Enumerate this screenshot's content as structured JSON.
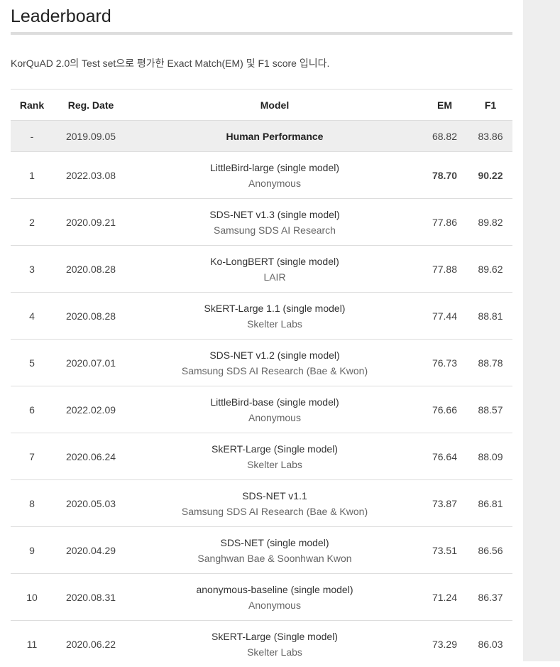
{
  "page": {
    "title": "Leaderboard",
    "description": "KorQuAD 2.0의 Test set으로 평가한 Exact Match(EM) 및 F1 score 입니다."
  },
  "table": {
    "headers": {
      "rank": "Rank",
      "date": "Reg. Date",
      "model": "Model",
      "em": "EM",
      "f1": "F1"
    },
    "human": {
      "rank": "-",
      "date": "2019.09.05",
      "model": "Human Performance",
      "em": "68.82",
      "f1": "83.86"
    },
    "rows": [
      {
        "rank": "1",
        "date": "2022.03.08",
        "model": "LittleBird-large (single model)",
        "institution": "Anonymous",
        "em": "78.70",
        "f1": "90.22"
      },
      {
        "rank": "2",
        "date": "2020.09.21",
        "model": "SDS-NET v1.3 (single model)",
        "institution": "Samsung SDS AI Research",
        "em": "77.86",
        "f1": "89.82"
      },
      {
        "rank": "3",
        "date": "2020.08.28",
        "model": "Ko-LongBERT (single model)",
        "institution": "LAIR",
        "em": "77.88",
        "f1": "89.62"
      },
      {
        "rank": "4",
        "date": "2020.08.28",
        "model": "SkERT-Large 1.1 (single model)",
        "institution": "Skelter Labs",
        "em": "77.44",
        "f1": "88.81"
      },
      {
        "rank": "5",
        "date": "2020.07.01",
        "model": "SDS-NET v1.2 (single model)",
        "institution": "Samsung SDS AI Research (Bae & Kwon)",
        "em": "76.73",
        "f1": "88.78"
      },
      {
        "rank": "6",
        "date": "2022.02.09",
        "model": "LittleBird-base (single model)",
        "institution": "Anonymous",
        "em": "76.66",
        "f1": "88.57"
      },
      {
        "rank": "7",
        "date": "2020.06.24",
        "model": "SkERT-Large (Single model)",
        "institution": "Skelter Labs",
        "em": "76.64",
        "f1": "88.09"
      },
      {
        "rank": "8",
        "date": "2020.05.03",
        "model": "SDS-NET v1.1",
        "institution": "Samsung SDS AI Research (Bae & Kwon)",
        "em": "73.87",
        "f1": "86.81"
      },
      {
        "rank": "9",
        "date": "2020.04.29",
        "model": "SDS-NET (single model)",
        "institution": "Sanghwan Bae & Soonhwan Kwon",
        "em": "73.51",
        "f1": "86.56"
      },
      {
        "rank": "10",
        "date": "2020.08.31",
        "model": "anonymous-baseline (single model)",
        "institution": "Anonymous",
        "em": "71.24",
        "f1": "86.37"
      },
      {
        "rank": "11",
        "date": "2020.06.22",
        "model": "SkERT-Large (Single model)",
        "institution": "Skelter Labs",
        "em": "73.29",
        "f1": "86.03"
      }
    ]
  }
}
